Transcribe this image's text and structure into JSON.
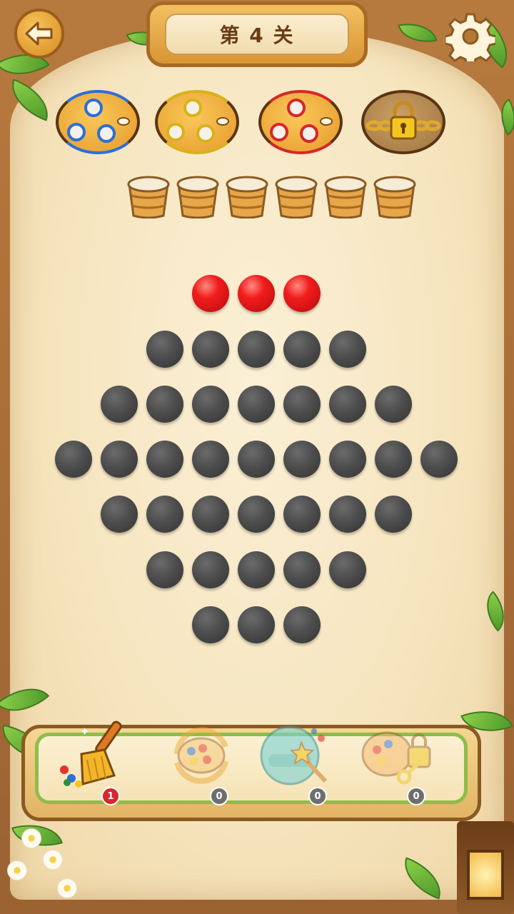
{
  "header": {
    "back_icon": "back-arrow-icon",
    "level_title": "第 4 关",
    "settings_icon": "gear-icon"
  },
  "trays": [
    {
      "name": "tray-blue",
      "color": "#2b6fd6",
      "holes": 3,
      "locked": false
    },
    {
      "name": "tray-yellow",
      "color": "#d8b21a",
      "holes": 3,
      "locked": false
    },
    {
      "name": "tray-red",
      "color": "#d6262a",
      "holes": 3,
      "locked": false
    },
    {
      "name": "tray-locked",
      "color": "#9f7440",
      "holes": 0,
      "locked": true
    }
  ],
  "buckets": {
    "count": 6,
    "state": "empty"
  },
  "board": {
    "ball_colors": {
      "red": "#e51b1b",
      "gray": "#4d4d4d"
    },
    "rows": [
      {
        "color": "red",
        "count": 3
      },
      {
        "color": "gray",
        "count": 5
      },
      {
        "color": "gray",
        "count": 7
      },
      {
        "color": "gray",
        "count": 9
      },
      {
        "color": "gray",
        "count": 7
      },
      {
        "color": "gray",
        "count": 5
      },
      {
        "color": "gray",
        "count": 3
      }
    ]
  },
  "tools": [
    {
      "name": "broom-tool",
      "icon": "broom-icon",
      "count": "1",
      "enabled": true
    },
    {
      "name": "shuffle-tool",
      "icon": "shuffle-palette-icon",
      "count": "0",
      "enabled": false
    },
    {
      "name": "magic-wand-tool",
      "icon": "magic-wand-bubble-icon",
      "count": "0",
      "enabled": false
    },
    {
      "name": "unlock-tool",
      "icon": "key-lock-palette-icon",
      "count": "0",
      "enabled": false
    }
  ]
}
